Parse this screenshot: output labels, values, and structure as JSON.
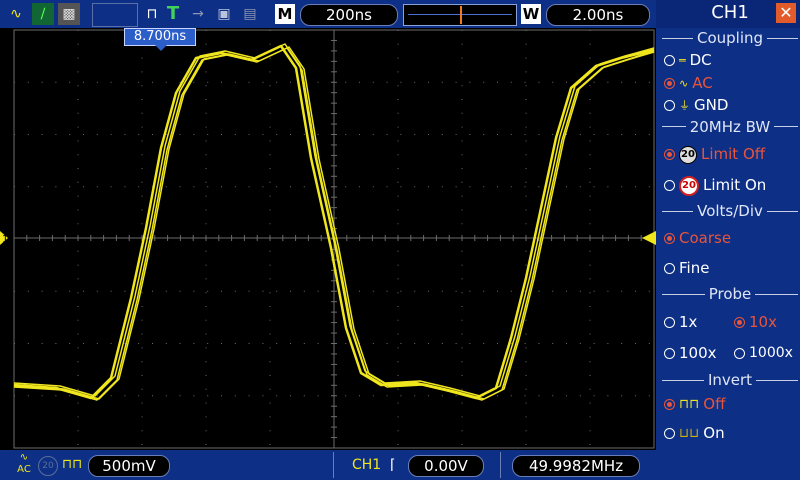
{
  "toolbar": {
    "timebase": "200ns",
    "m_label": "M",
    "w_label": "W",
    "window_value": "2.00ns",
    "cursor_label": "8.700ns",
    "trig_letter": "T"
  },
  "panel": {
    "title": "CH1",
    "close_icon": "close-icon",
    "coupling": {
      "title": "Coupling",
      "options": [
        "DC",
        "AC",
        "GND"
      ],
      "selected": "AC"
    },
    "bw": {
      "title": "20MHz BW",
      "options": [
        "Limit Off",
        "Limit On"
      ],
      "selected": "Limit Off"
    },
    "volts": {
      "title": "Volts/Div",
      "options": [
        "Coarse",
        "Fine"
      ],
      "selected": "Coarse"
    },
    "probe": {
      "title": "Probe",
      "options": [
        "1x",
        "10x",
        "100x",
        "1000x"
      ],
      "selected": "10x"
    },
    "invert": {
      "title": "Invert",
      "options": [
        "Off",
        "On"
      ],
      "selected": "Off"
    }
  },
  "bottom": {
    "coupling_tag": "AC",
    "volts_div": "500mV",
    "trig_channel": "CH1",
    "trig_level": "0.00V",
    "frequency": "49.9982MHz"
  },
  "screen": {
    "channel_marker": "1",
    "trace_color": "#f0e61e",
    "grid_color": "#6c6c6c"
  }
}
